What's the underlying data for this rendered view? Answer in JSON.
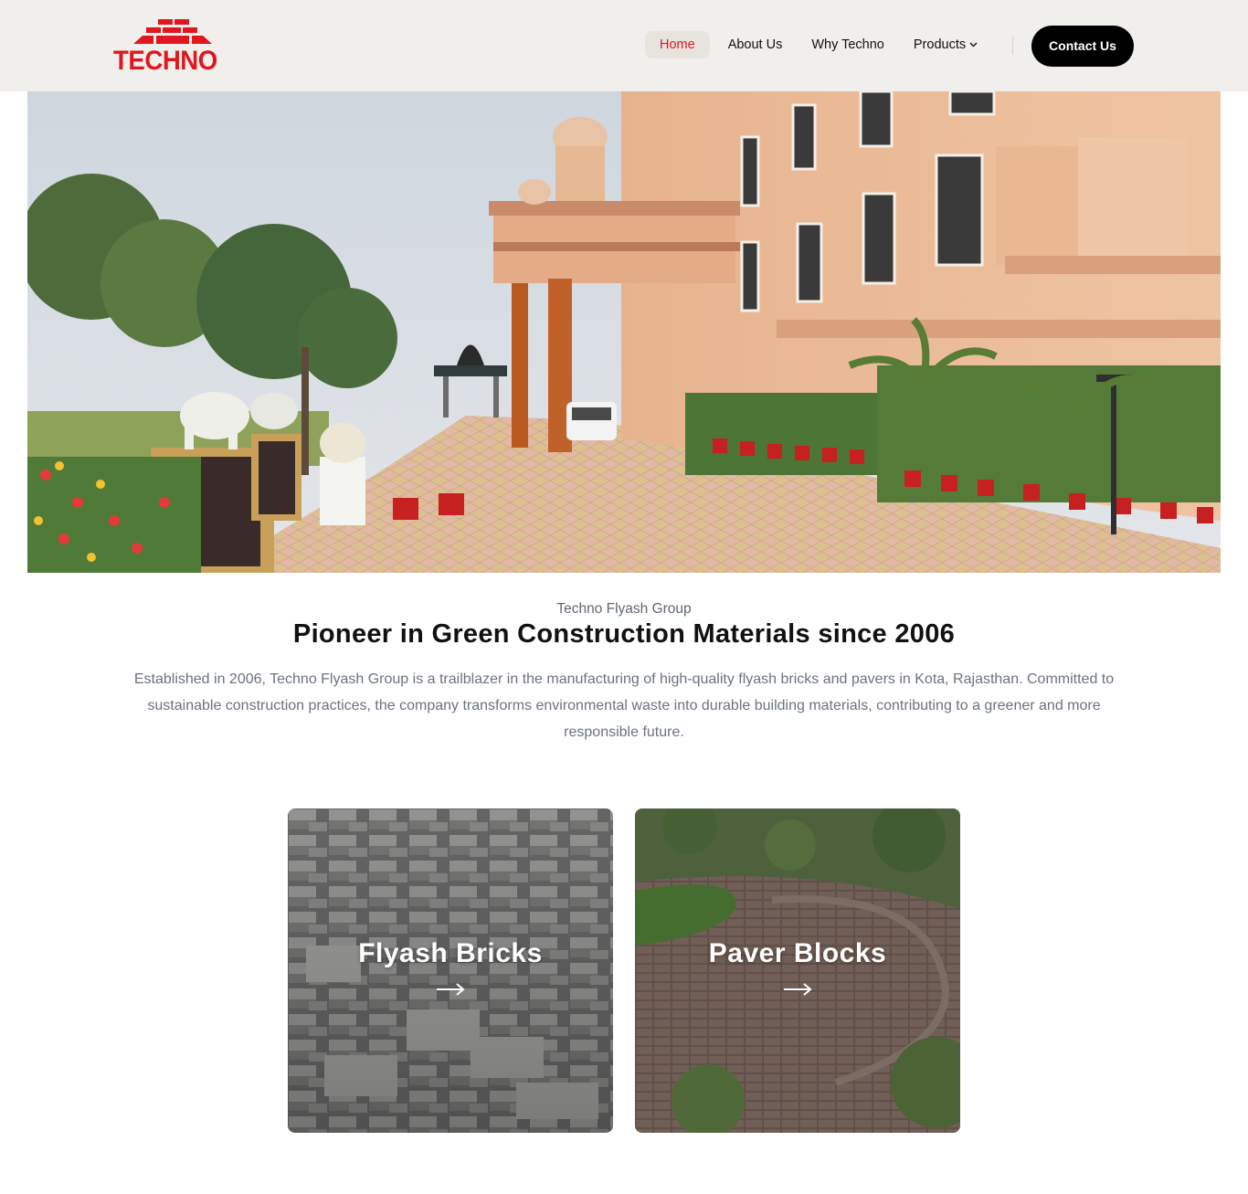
{
  "header": {
    "logo_text": "TECHNO",
    "nav": {
      "home": "Home",
      "about": "About Us",
      "why": "Why Techno",
      "products": "Products"
    },
    "contact_label": "Contact Us"
  },
  "intro": {
    "eyebrow": "Techno Flyash Group",
    "headline": "Pioneer in Green Construction Materials since 2006",
    "paragraph": "Established in 2006, Techno Flyash Group is a trailblazer in the manufacturing of high-quality flyash bricks and pavers in Kota, Rajasthan. Committed to sustainable construction practices, the company transforms environmental waste into durable building materials, contributing to a greener and more responsible future."
  },
  "cards": [
    {
      "title": "Flyash Bricks"
    },
    {
      "title": "Paver Blocks"
    }
  ],
  "colors": {
    "brand_red": "#e0171e",
    "header_bg": "#f1efeb",
    "button_bg": "#000000",
    "muted_text": "#6b7280"
  },
  "icons": {
    "dropdown": "chevron-down-icon",
    "card_link": "arrow-right-icon"
  }
}
